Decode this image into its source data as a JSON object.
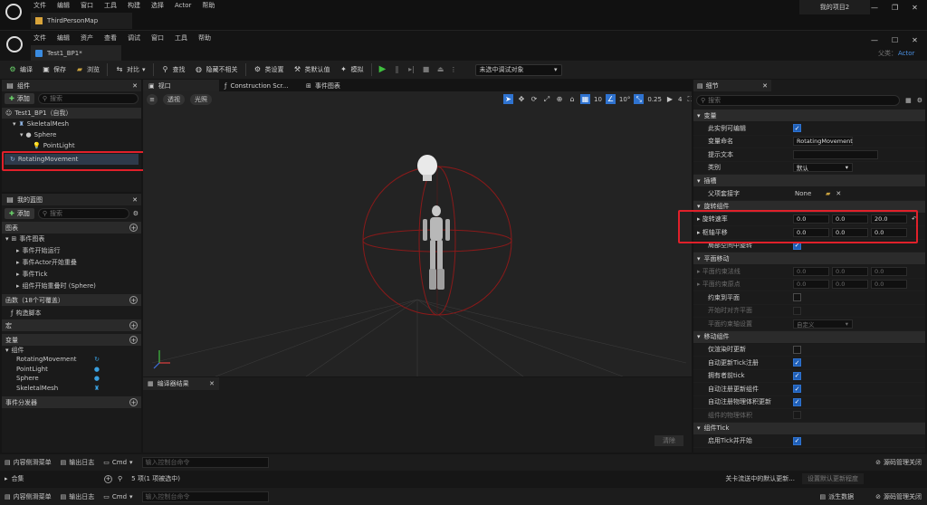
{
  "top_bar": {
    "menu": [
      "文件",
      "编辑",
      "窗口",
      "工具",
      "构建",
      "选择",
      "Actor",
      "帮助"
    ],
    "map_tab": "ThirdPersonMap",
    "project": "我的项目2"
  },
  "bp_bar": {
    "menu": [
      "文件",
      "编辑",
      "资产",
      "查看",
      "调试",
      "窗口",
      "工具",
      "帮助"
    ],
    "tab": "Test1_BP1*",
    "parent_label": "父类：",
    "parent_value": "Actor"
  },
  "toolbar": {
    "compile": "编译",
    "save": "保存",
    "browse": "浏览",
    "diff": "对比",
    "find": "查找",
    "hide_unrelated": "隐藏不相关",
    "class_settings": "类设置",
    "class_defaults": "类默认值",
    "simulate": "模拟",
    "debug_select": "未选中调试对象"
  },
  "components": {
    "title": "组件",
    "add": "添加",
    "search_placeholder": "搜索",
    "root": "Test1_BP1（自我）",
    "items": [
      "SkeletalMesh",
      "Sphere",
      "PointLight",
      "RotatingMovement"
    ]
  },
  "my_blueprint": {
    "title": "我的蓝图",
    "add": "添加",
    "search_placeholder": "搜索",
    "graphs_header": "图表",
    "event_graph": "事件图表",
    "events": [
      "事件开始运行",
      "事件Actor开始重叠",
      "事件Tick",
      "组件开始重叠时 (Sphere)"
    ],
    "functions_header": "函数（18个可覆盖）",
    "construction_script": "构造脚本",
    "macros_header": "宏",
    "variables_header": "变量",
    "components_group": "组件",
    "variables": [
      "RotatingMovement",
      "PointLight",
      "Sphere",
      "SkeletalMesh"
    ],
    "dispatchers_header": "事件分发器"
  },
  "viewport_tabs": {
    "viewport": "视口",
    "construction": "Construction Scr...",
    "event_graph": "事件图表"
  },
  "viewport": {
    "perspective": "透视",
    "lit": "光照",
    "grid_snap": "10",
    "rot_snap": "10°",
    "scale_snap": "0.25",
    "camera_speed": "4"
  },
  "compiler": {
    "title": "编译器结果",
    "clear": "清除"
  },
  "details": {
    "title": "细节",
    "search_placeholder": "搜索",
    "cat_variable": "变量",
    "instance_editable": "此实例可编辑",
    "variable_name_label": "变量命名",
    "variable_name": "RotatingMovement",
    "tooltip_label": "提示文本",
    "category_label": "类别",
    "category_value": "默认",
    "cat_socket": "插槽",
    "parent_socket_label": "父项套接字",
    "parent_socket_value": "None",
    "cat_rotating": "旋转组件",
    "rotation_rate_label": "旋转速率",
    "rotation_rate": [
      "0.0",
      "0.0",
      "20.0"
    ],
    "pivot_label": "枢轴平移",
    "pivot": [
      "0.0",
      "0.0",
      "0.0"
    ],
    "local_space_label": "局部空间中旋转",
    "cat_planar": "平面移动",
    "plane_normal_label": "平面约束法线",
    "plane_normal": [
      "0.0",
      "0.0",
      "0.0"
    ],
    "plane_origin_label": "平面约束原点",
    "plane_origin": [
      "0.0",
      "0.0",
      "0.0"
    ],
    "constrain_label": "约束到平面",
    "snap_start_label": "开始时对齐平面",
    "plane_axis_label": "平面约束轴设置",
    "plane_axis_value": "自定义",
    "cat_movement": "移动组件",
    "update_only_label": "仅渲染时更新",
    "auto_tick_label": "自动更新Tick注册",
    "tick_before_owner_label": "拥有者前tick",
    "auto_register_label": "自动注册更新组件",
    "auto_register_physics_label": "自动注册物理体积更新",
    "physics_volume_label": "组件的物理体积",
    "cat_tick": "组件Tick",
    "tick_start_label": "启用Tick并开始"
  },
  "bottom": {
    "content_drawer": "内容侧滑菜单",
    "output_log": "输出日志",
    "cmd": "Cmd",
    "console_placeholder": "输入控制台命令",
    "source_control": "源码管理关闭",
    "collections": "合集",
    "items_selected": "5 项(1 项被选中)",
    "info_text": "关卡流送中的默认更新...",
    "settings_text": "设置默认更新程度",
    "derived_data": "派生数据"
  },
  "colors": {
    "accent": "#2f73d0",
    "highlight_box": "#e0202a",
    "play_green": "#3fbf3f"
  }
}
